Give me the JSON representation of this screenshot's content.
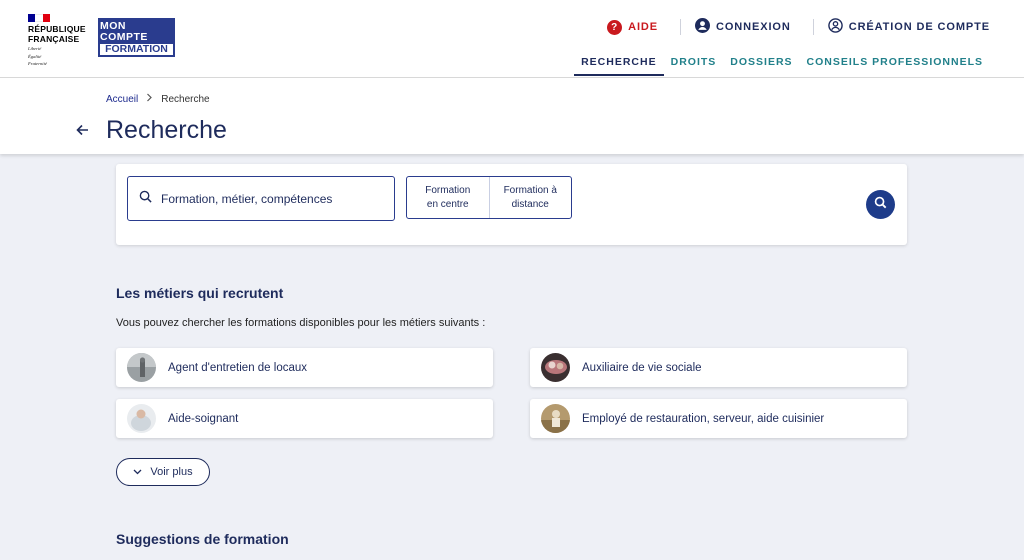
{
  "brand": {
    "republique_line1": "RÉPUBLIQUE",
    "republique_line2": "FRANÇAISE",
    "motto": [
      "Liberté",
      "Égalité",
      "Fraternité"
    ],
    "logo_line1": "MON COMPTE",
    "logo_line2": "FORMATION",
    "colors": {
      "blue": "#000091",
      "white": "#ffffff",
      "red": "#e1000f",
      "navy": "#1e2b5c"
    }
  },
  "top_links": {
    "aide": "AIDE",
    "connexion": "CONNEXION",
    "creation": "CRÉATION DE COMPTE"
  },
  "nav": {
    "items": [
      {
        "label": "RECHERCHE",
        "active": true
      },
      {
        "label": "DROITS",
        "active": false
      },
      {
        "label": "DOSSIERS",
        "active": false
      },
      {
        "label": "CONSEILS PROFESSIONNELS",
        "active": false
      }
    ]
  },
  "breadcrumb": {
    "home": "Accueil",
    "current": "Recherche"
  },
  "page": {
    "title": "Recherche"
  },
  "search": {
    "placeholder": "Formation, métier, compétences",
    "mode_centre_line1": "Formation",
    "mode_centre_line2": "en centre",
    "mode_distance_line1": "Formation à",
    "mode_distance_line2": "distance"
  },
  "metiers": {
    "title": "Les métiers qui recrutent",
    "description": "Vous pouvez chercher les formations disponibles pour les métiers suivants :",
    "jobs": [
      {
        "label": "Agent d'entretien de locaux"
      },
      {
        "label": "Auxiliaire de vie sociale"
      },
      {
        "label": "Aide-soignant"
      },
      {
        "label": "Employé de restauration, serveur, aide cuisinier"
      }
    ],
    "voir_plus": "Voir plus"
  },
  "suggestions": {
    "title": "Suggestions de formation"
  }
}
